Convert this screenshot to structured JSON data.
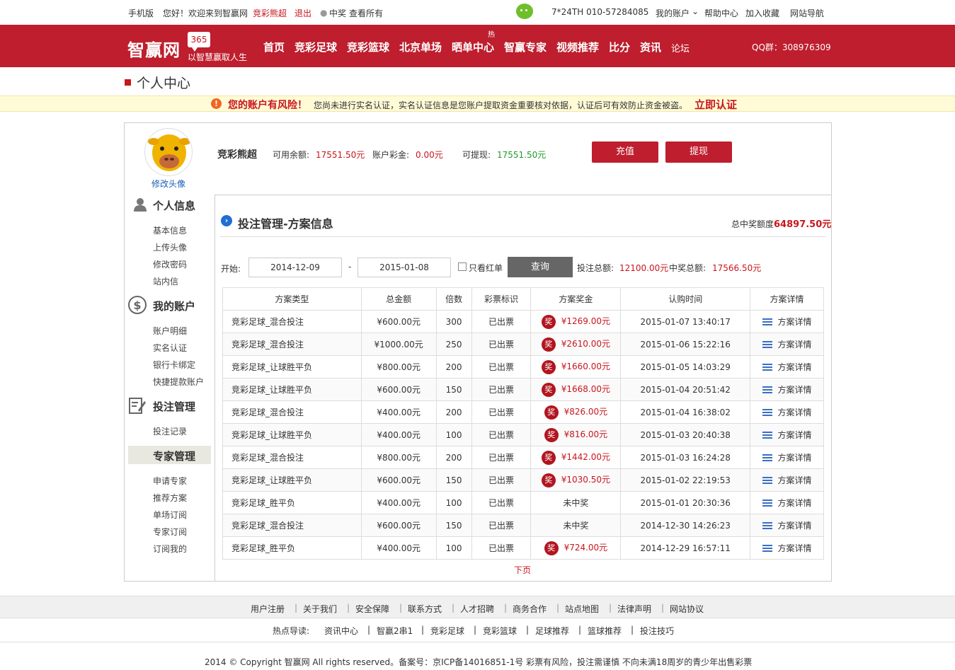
{
  "topbar": {
    "mobile": "手机版",
    "greeting": "您好！欢迎来到智赢网",
    "username": "竞彩熊超",
    "logout": "退出",
    "prize_label": "中奖",
    "view_all": "查看所有",
    "hotline": "7*24TH  010-57284085",
    "my_account": "我的账户",
    "help": "帮助中心",
    "favorite": "加入收藏",
    "site_nav": "网站导航"
  },
  "nav": {
    "logo": "智赢网",
    "badge": "365",
    "slogan": "以智慧赢取人生",
    "items": [
      "首页",
      "竞彩足球",
      "竞彩篮球",
      "北京单场",
      "晒单中心",
      "智赢专家",
      "视频推荐",
      "比分",
      "资讯",
      "论坛"
    ],
    "hot_tag": "热",
    "qq": "QQ群：308976309"
  },
  "page_title": "个人中心",
  "warning": {
    "icon": "!",
    "title": "您的账户有风险！",
    "text": "您尚未进行实名认证，实名认证信息是您账户提取资金重要核对依据，认证后可有效防止资金被盗。",
    "link": "立即认证"
  },
  "user": {
    "name": "竞彩熊超",
    "change_avatar": "修改头像",
    "balance_label": "可用余额:",
    "balance": "17551.50元",
    "bonus_label": "账户彩金:",
    "bonus": "0.00元",
    "withdrawable_label": "可提现:",
    "withdrawable": "17551.50元",
    "recharge": "充值",
    "withdraw": "提现"
  },
  "sidebar": {
    "personal": "个人信息",
    "personal_items": [
      "基本信息",
      "上传头像",
      "修改密码",
      "站内信"
    ],
    "account": "我的账户",
    "account_items": [
      "账户明细",
      "实名认证",
      "银行卡绑定",
      "快捷提款账户"
    ],
    "betting": "投注管理",
    "betting_items": [
      "投注记录"
    ],
    "expert": "专家管理",
    "expert_items": [
      "申请专家",
      "推荐方案",
      "单场订阅",
      "专家订阅",
      "订阅我的"
    ]
  },
  "content": {
    "title": "投注管理-方案信息",
    "total_prize_label": "总中奖额度",
    "total_prize": "64897.50元",
    "start_label": "开始:",
    "start_date": "2014-12-09",
    "dash": "-",
    "end_date": "2015-01-08",
    "red_only": "只看红单",
    "query": "查询",
    "bet_total_label": "投注总额:",
    "bet_total": "12100.00元",
    "win_total_label": "中奖总额:",
    "win_total": "17566.50元",
    "next_page": "下页"
  },
  "table": {
    "headers": [
      "方案类型",
      "总金额",
      "倍数",
      "彩票标识",
      "方案奖金",
      "认购时间",
      "方案详情"
    ],
    "prize_icon": "奖",
    "rows": [
      {
        "type": "竞彩足球_混合投注",
        "amount": "¥600.00元",
        "multi": "300",
        "status": "已出票",
        "prize": "¥1269.00元",
        "won": true,
        "time": "2015-01-07 13:40:17",
        "detail": "方案详情"
      },
      {
        "type": "竞彩足球_混合投注",
        "amount": "¥1000.00元",
        "multi": "250",
        "status": "已出票",
        "prize": "¥2610.00元",
        "won": true,
        "time": "2015-01-06 15:22:16",
        "detail": "方案详情"
      },
      {
        "type": "竞彩足球_让球胜平负",
        "amount": "¥800.00元",
        "multi": "200",
        "status": "已出票",
        "prize": "¥1660.00元",
        "won": true,
        "time": "2015-01-05 14:03:29",
        "detail": "方案详情"
      },
      {
        "type": "竞彩足球_让球胜平负",
        "amount": "¥600.00元",
        "multi": "150",
        "status": "已出票",
        "prize": "¥1668.00元",
        "won": true,
        "time": "2015-01-04 20:51:42",
        "detail": "方案详情"
      },
      {
        "type": "竞彩足球_混合投注",
        "amount": "¥400.00元",
        "multi": "200",
        "status": "已出票",
        "prize": "¥826.00元",
        "won": true,
        "time": "2015-01-04 16:38:02",
        "detail": "方案详情"
      },
      {
        "type": "竞彩足球_让球胜平负",
        "amount": "¥400.00元",
        "multi": "100",
        "status": "已出票",
        "prize": "¥816.00元",
        "won": true,
        "time": "2015-01-03 20:40:38",
        "detail": "方案详情"
      },
      {
        "type": "竞彩足球_混合投注",
        "amount": "¥800.00元",
        "multi": "200",
        "status": "已出票",
        "prize": "¥1442.00元",
        "won": true,
        "time": "2015-01-03 16:24:28",
        "detail": "方案详情"
      },
      {
        "type": "竞彩足球_让球胜平负",
        "amount": "¥600.00元",
        "multi": "150",
        "status": "已出票",
        "prize": "¥1030.50元",
        "won": true,
        "time": "2015-01-02 22:19:53",
        "detail": "方案详情"
      },
      {
        "type": "竞彩足球_胜平负",
        "amount": "¥400.00元",
        "multi": "100",
        "status": "已出票",
        "prize": "未中奖",
        "won": false,
        "time": "2015-01-01 20:30:36",
        "detail": "方案详情"
      },
      {
        "type": "竞彩足球_混合投注",
        "amount": "¥600.00元",
        "multi": "150",
        "status": "已出票",
        "prize": "未中奖",
        "won": false,
        "time": "2014-12-30 14:26:23",
        "detail": "方案详情"
      },
      {
        "type": "竞彩足球_胜平负",
        "amount": "¥400.00元",
        "multi": "100",
        "status": "已出票",
        "prize": "¥724.00元",
        "won": true,
        "time": "2014-12-29 16:57:11",
        "detail": "方案详情"
      }
    ]
  },
  "footer": {
    "links": [
      "用户注册",
      "关于我们",
      "安全保障",
      "联系方式",
      "人才招聘",
      "商务合作",
      "站点地图",
      "法律声明",
      "网站协议"
    ],
    "hot_label": "热点导读:",
    "hot_links": [
      "资讯中心",
      "智赢2串1",
      "竞彩足球",
      "竞彩篮球",
      "足球推荐",
      "篮球推荐",
      "投注技巧"
    ],
    "copyright": "2014 © Copyright   智赢网   All rights reserved。备案号：京ICP备14016851-1号 彩票有风险，投注需谨慎 不向未满18周岁的青少年出售彩票"
  },
  "colors": {
    "brand": "#be1e2d",
    "warning_bg": "#fffbd7",
    "link_blue": "#1a5fb4",
    "green": "#219a2a"
  }
}
